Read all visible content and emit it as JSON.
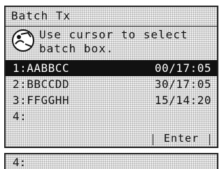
{
  "screen": {
    "title": "Batch Tx",
    "instruction": {
      "line1": "Use cursor to select",
      "line2": "batch box."
    },
    "icon": "operator-help-icon"
  },
  "boxes": [
    {
      "name": "1:AABBCC",
      "time": "00/17:05",
      "selected": true
    },
    {
      "name": "2:BBCCDD",
      "time": "30/17:05",
      "selected": false
    },
    {
      "name": "3:FFGGHH",
      "time": "15/14:20",
      "selected": false
    },
    {
      "name": "4:",
      "time": "",
      "selected": false
    }
  ],
  "softkey": {
    "label": "Enter"
  },
  "bottom_field": {
    "name": "4:"
  }
}
